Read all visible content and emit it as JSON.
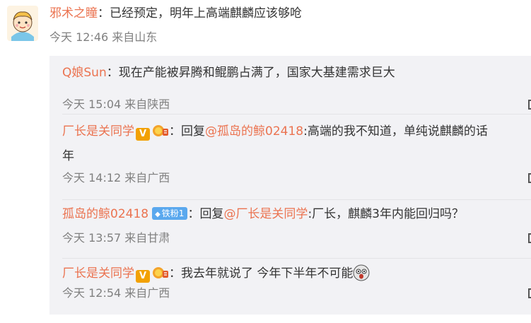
{
  "main_comment": {
    "username": "邪术之瞳",
    "separator": "：",
    "text": "已经预定，明年上高端麒麟应该够呛",
    "time": "今天 12:46",
    "source": "来自山东"
  },
  "replies": [
    {
      "username": "Q娘Sun",
      "separator": "：",
      "text": "现在产能被昇腾和鲲鹏占满了，国家大基建需求巨大",
      "time": "今天 15:04",
      "source": "来自陕西"
    },
    {
      "username": "厂长是关同学",
      "vbadge": "V",
      "separator": "：",
      "reply_prefix": "回复",
      "mention": "@孤岛的鲸02418",
      "text": ":高端的我不知道，单纯说麒麟的话",
      "text_cont": "年",
      "time": "今天 14:12",
      "source": "来自广西"
    },
    {
      "username": "孤岛的鲸02418",
      "fan_badge": "铁粉1",
      "separator": "：",
      "reply_prefix": "回复",
      "mention": "@厂长是关同学",
      "text": ":厂长，麒麟3年内能回归吗？",
      "time": "今天 13:57",
      "source": "来自甘肃"
    },
    {
      "username": "厂长是关同学",
      "vbadge": "V",
      "separator": "：",
      "text": "我去年就说了 今年下半年不可能",
      "emoji": "shocked-face-emoji",
      "time": "今天 12:54",
      "source": "来自广西"
    }
  ],
  "colors": {
    "username": "#eb7350",
    "meta": "#808080",
    "reply_bg": "#f2f2f5",
    "vbadge": "#f2a102",
    "fan_badge": "#5aa8ee"
  },
  "icons": {
    "avatar": "cartoon-boy-avatar",
    "rank_badge": "rank-medal-icon",
    "action": "action-icon"
  }
}
